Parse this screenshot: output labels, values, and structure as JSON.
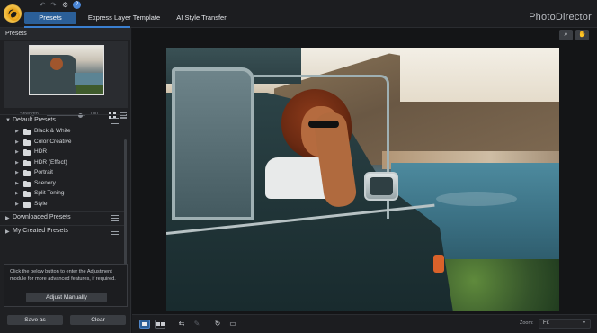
{
  "app": {
    "brand": "PhotoDirector"
  },
  "quick_access": {
    "undo_icon": "undo-icon",
    "redo_icon": "redo-icon",
    "settings_icon": "gear-icon",
    "help_icon": "help-icon",
    "help_text": "?"
  },
  "tabs": [
    {
      "label": "Presets",
      "active": true
    },
    {
      "label": "Express Layer Template",
      "active": false
    },
    {
      "label": "AI Style Transfer",
      "active": false
    }
  ],
  "left_panel": {
    "title": "Presets",
    "strength": {
      "label": "Strength",
      "value": "100"
    },
    "groups": [
      {
        "label": "Default Presets",
        "expanded": true,
        "items": [
          "Black & White",
          "Color Creative",
          "HDR",
          "HDR (Effect)",
          "Portrait",
          "Scenery",
          "Split Toning",
          "Style"
        ]
      },
      {
        "label": "Downloaded Presets",
        "expanded": false
      },
      {
        "label": "My Created Presets",
        "expanded": false
      }
    ],
    "adjust_text": "Click the below button to enter the Adjustment module for more advanced features, if required.",
    "adjust_button": "Adjust Manually",
    "save_as_button": "Save as",
    "clear_button": "Clear"
  },
  "bottom_bar": {
    "zoom_label": "Zoom:",
    "zoom_value": "Fit"
  },
  "colors": {
    "accent": "#2b5f98",
    "background": "#16171a",
    "panel": "#1f2023"
  }
}
